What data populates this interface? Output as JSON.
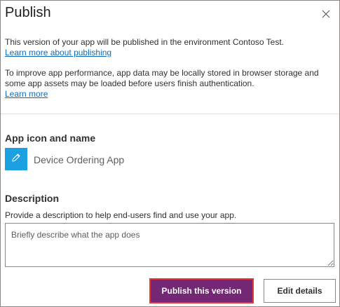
{
  "dialog": {
    "title": "Publish",
    "close_icon": "close-icon"
  },
  "intro": {
    "line1": "This version of your app will be published in the environment Contoso Test.",
    "link1": "Learn more about publishing",
    "line2": "To improve app performance, app data may be locally stored in browser storage and some app assets may be loaded before users finish authentication.",
    "link2": "Learn more"
  },
  "app_section": {
    "heading": "App icon and name",
    "icon": "pencil-icon",
    "icon_bg_color": "#1ba1e2",
    "app_name": "Device Ordering App"
  },
  "description_section": {
    "heading": "Description",
    "help_text": "Provide a description to help end-users find and use your app.",
    "placeholder": "Briefly describe what the app does",
    "value": ""
  },
  "buttons": {
    "publish_label": "Publish this version",
    "edit_label": "Edit details",
    "primary_color": "#742774",
    "highlight_color": "#e3383b"
  }
}
